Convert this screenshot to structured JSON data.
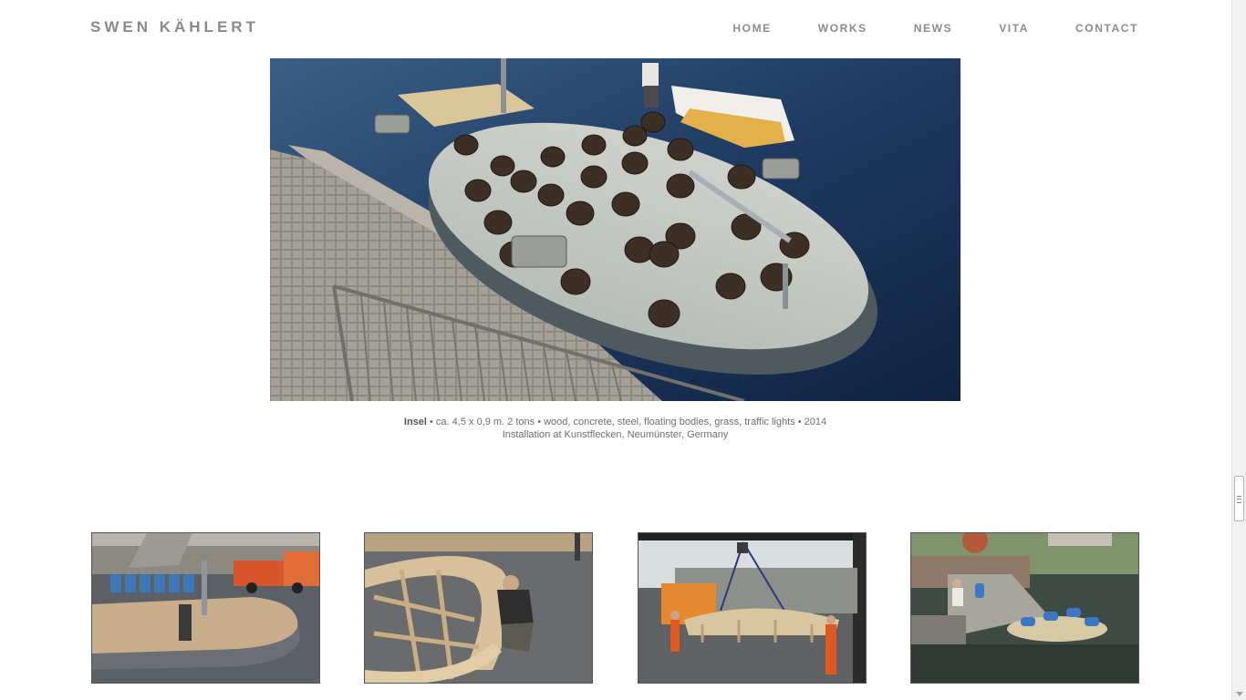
{
  "site": {
    "title": "SWEN KÄHLERT"
  },
  "nav": {
    "items": [
      {
        "label": "HOME"
      },
      {
        "label": "WORKS"
      },
      {
        "label": "NEWS"
      },
      {
        "label": "VITA"
      },
      {
        "label": "CONTACT"
      }
    ]
  },
  "artwork": {
    "title": "Insel",
    "details": " • ca. 4,5 x 0,9 m. 2 tons • wood, concrete, steel, floating bodies, grass, traffic lights • 2014",
    "location": "Installation at Kunstflecken, Neumünster, Germany"
  },
  "colors": {
    "nav_text": "#8c8c8c",
    "title_text": "#8a8a8a",
    "caption_text": "#6f6f6f"
  },
  "icons": {
    "scrollbar_grip": "scroll-grip-icon",
    "scrollbar_down": "arrow-down-icon"
  }
}
